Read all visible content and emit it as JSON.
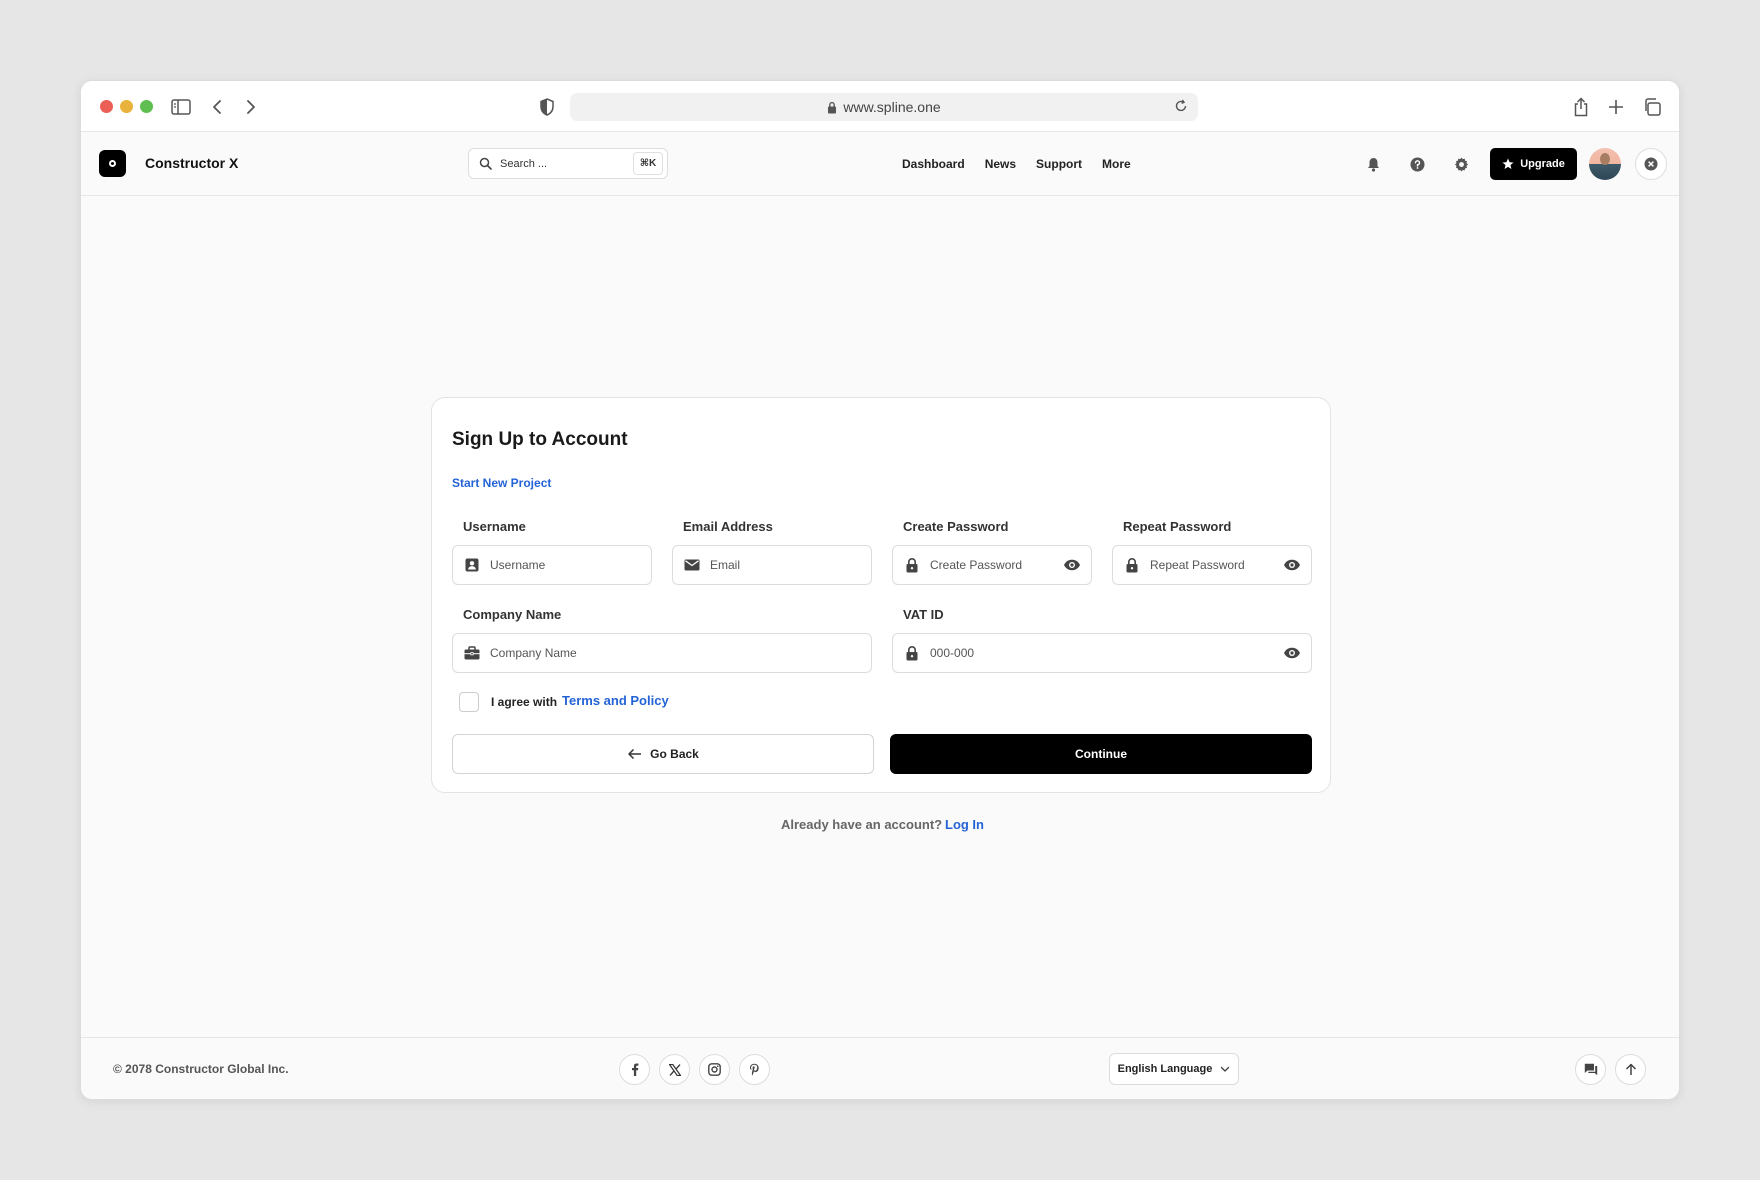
{
  "browser": {
    "url": "www.spline.one"
  },
  "header": {
    "brand": "Constructor X",
    "search_placeholder": "Search ...",
    "search_shortcut": "⌘K",
    "nav": [
      "Dashboard",
      "News",
      "Support",
      "More"
    ],
    "upgrade_label": "Upgrade"
  },
  "form": {
    "title": "Sign Up to Account",
    "subtitle_link": "Start New Project",
    "fields": {
      "username": {
        "label": "Username",
        "placeholder": "Username"
      },
      "email": {
        "label": "Email Address",
        "placeholder": "Email"
      },
      "create_password": {
        "label": "Create Password",
        "placeholder": "Create Password"
      },
      "repeat_password": {
        "label": "Repeat Password",
        "placeholder": "Repeat Password"
      },
      "company": {
        "label": "Company Name",
        "placeholder": "Company Name"
      },
      "vat": {
        "label": "VAT ID",
        "placeholder": "000-000"
      }
    },
    "agree_text": "I agree with",
    "terms_link": "Terms and Policy",
    "back_label": "Go Back",
    "continue_label": "Continue",
    "already_text": "Already have an account?",
    "login_link": "Log In"
  },
  "footer": {
    "copyright": "© 2078 Constructor Global Inc.",
    "social": [
      "facebook-icon",
      "x-icon",
      "instagram-icon",
      "pinterest-icon"
    ],
    "language": "English Language"
  },
  "colors": {
    "accent": "#2463d6",
    "primary_button": "#000000"
  }
}
